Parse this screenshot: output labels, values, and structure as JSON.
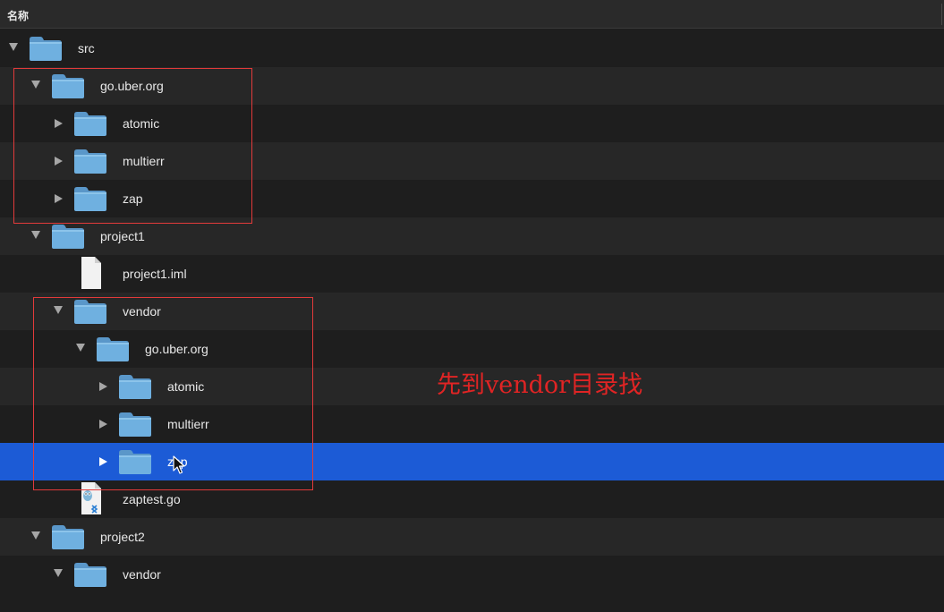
{
  "header": {
    "name_column": "名称"
  },
  "tree": [
    {
      "label": "src",
      "kind": "folder",
      "depth": 0,
      "disclosure": "open"
    },
    {
      "label": "go.uber.org",
      "kind": "folder",
      "depth": 1,
      "disclosure": "open"
    },
    {
      "label": "atomic",
      "kind": "folder",
      "depth": 2,
      "disclosure": "closed"
    },
    {
      "label": "multierr",
      "kind": "folder",
      "depth": 2,
      "disclosure": "closed"
    },
    {
      "label": "zap",
      "kind": "folder",
      "depth": 2,
      "disclosure": "closed"
    },
    {
      "label": "project1",
      "kind": "folder",
      "depth": 1,
      "disclosure": "open"
    },
    {
      "label": "project1.iml",
      "kind": "file-blank",
      "depth": 2,
      "disclosure": "none"
    },
    {
      "label": "vendor",
      "kind": "folder",
      "depth": 2,
      "disclosure": "open"
    },
    {
      "label": "go.uber.org",
      "kind": "folder",
      "depth": 3,
      "disclosure": "open"
    },
    {
      "label": "atomic",
      "kind": "folder",
      "depth": 4,
      "disclosure": "closed"
    },
    {
      "label": "multierr",
      "kind": "folder",
      "depth": 4,
      "disclosure": "closed"
    },
    {
      "label": "zap",
      "kind": "folder",
      "depth": 4,
      "disclosure": "closed",
      "selected": true
    },
    {
      "label": "zaptest.go",
      "kind": "file-go",
      "depth": 2,
      "disclosure": "none"
    },
    {
      "label": "project2",
      "kind": "folder",
      "depth": 1,
      "disclosure": "open"
    },
    {
      "label": "vendor",
      "kind": "folder",
      "depth": 2,
      "disclosure": "open"
    }
  ],
  "annotation": {
    "text": "先到vendor目录找"
  },
  "colors": {
    "background": "#1e1e1e",
    "alt_row": "#272727",
    "selection": "#1c5bd6",
    "folder": "#6fb0e0",
    "annotation_red": "#e02424"
  }
}
